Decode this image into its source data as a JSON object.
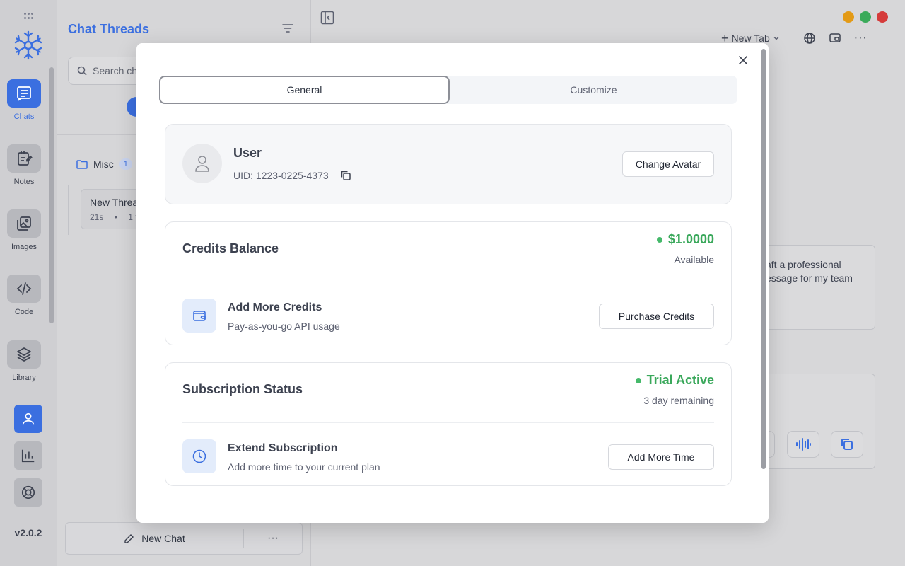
{
  "rail": {
    "items": [
      {
        "label": "Chats",
        "icon": "chat-icon",
        "active": true
      },
      {
        "label": "Notes",
        "icon": "notes-icon",
        "active": false
      },
      {
        "label": "Images",
        "icon": "images-icon",
        "active": false
      },
      {
        "label": "Code",
        "icon": "code-icon",
        "active": false
      },
      {
        "label": "Library",
        "icon": "library-icon",
        "active": false
      }
    ],
    "bottom_icons": [
      "user-icon",
      "chart-icon",
      "lifebuoy-icon"
    ],
    "version": "v2.0.2"
  },
  "threads": {
    "title": "Chat Threads",
    "search_placeholder": "Search ch",
    "folder": {
      "name": "Misc",
      "count": "1"
    },
    "thread": {
      "title": "New Threa",
      "age": "21s",
      "meta": "1 t"
    },
    "new_chat_label": "New Chat",
    "more_label": "···"
  },
  "toolbar": {
    "new_tab_label": "New Tab"
  },
  "background": {
    "card_text_line1": "aft a professional",
    "card_text_line2": "essage for my team"
  },
  "modal": {
    "tabs": [
      {
        "label": "General",
        "active": true
      },
      {
        "label": "Customize",
        "active": false
      }
    ],
    "user": {
      "name": "User",
      "uid": "UID: 1223-0225-4373",
      "change_avatar_label": "Change Avatar"
    },
    "credits": {
      "title": "Credits Balance",
      "amount": "$1.0000",
      "amount_sub": "Available",
      "feature_title": "Add More Credits",
      "feature_desc": "Pay-as-you-go API usage",
      "button_label": "Purchase Credits"
    },
    "subscription": {
      "title": "Subscription Status",
      "status": "Trial Active",
      "status_sub": "3 day remaining",
      "feature_title": "Extend Subscription",
      "feature_desc": "Add more time to your current plan",
      "button_label": "Add More Time"
    }
  },
  "colors": {
    "accent": "#3b6fe0",
    "success": "#3aa85b",
    "traffic_yellow": "#e39a16",
    "traffic_green": "#3aaa5a",
    "traffic_red": "#d53b3b"
  }
}
